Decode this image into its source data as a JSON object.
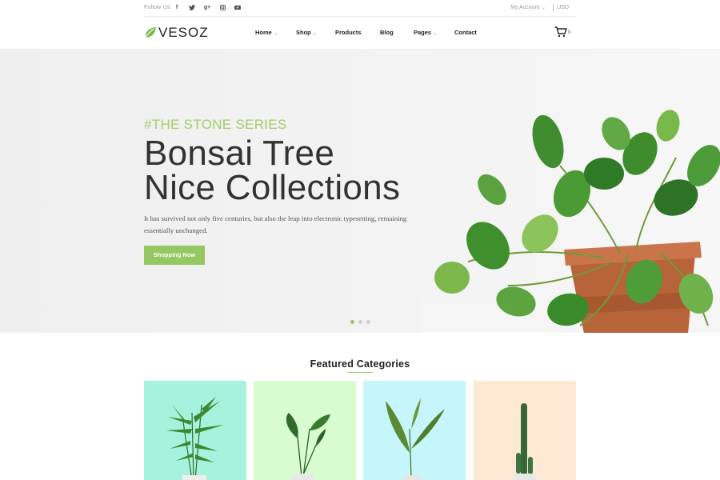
{
  "topbar": {
    "follow_label": "Follow Us:",
    "social_icons": [
      "facebook-icon",
      "twitter-icon",
      "google-plus-icon",
      "instagram-icon",
      "youtube-icon"
    ],
    "account_label": "My Account",
    "currency_label": "USD"
  },
  "header": {
    "logo_text": "VESOZ",
    "nav": [
      {
        "label": "Home",
        "dropdown": true
      },
      {
        "label": "Shop",
        "dropdown": true
      },
      {
        "label": "Products",
        "dropdown": false
      },
      {
        "label": "Blog",
        "dropdown": false
      },
      {
        "label": "Pages",
        "dropdown": true
      },
      {
        "label": "Contact",
        "dropdown": false
      }
    ],
    "cart_count": "0"
  },
  "hero": {
    "tag": "#THE STONE SERIES",
    "title_line1": "Bonsai Tree",
    "title_line2": "Nice Collections",
    "description": "It has survived not only five centuries, but also the leap into electronic typesetting, remaining essentially unchanged.",
    "button_label": "Shopping Now",
    "slides": 3,
    "active_slide": 1
  },
  "featured": {
    "title": "Featured Categories",
    "categories": [
      {
        "bg": "#a6f2dd",
        "plant": "palm"
      },
      {
        "bg": "#d8fccf",
        "plant": "broadleaf"
      },
      {
        "bg": "#c6f6fb",
        "plant": "sprout"
      },
      {
        "bg": "#fde9d4",
        "plant": "cactus"
      }
    ]
  },
  "colors": {
    "accent": "#95c762",
    "accent_text": "#a3cd6a",
    "heading": "#333333"
  }
}
